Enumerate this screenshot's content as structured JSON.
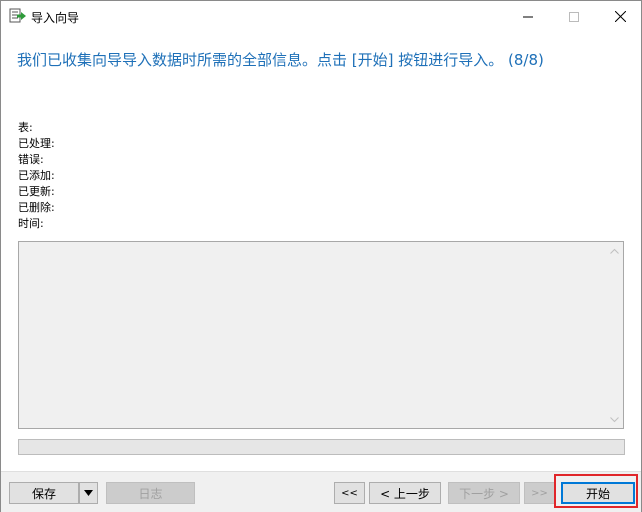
{
  "window": {
    "title": "导入向导"
  },
  "heading": "我们已收集向导导入数据时所需的全部信息。点击 [开始] 按钮进行导入。 (8/8)",
  "info_labels": [
    "表:",
    "已处理:",
    "错误:",
    "已添加:",
    "已更新:",
    "已删除:",
    "时间:"
  ],
  "buttons": {
    "save": "保存",
    "log": "日志",
    "first": "<<",
    "prev": "< 上一步",
    "next": "下一步 >",
    "last": ">>",
    "start": "开始"
  },
  "progress": {
    "value": 0
  },
  "icons": [
    "import-wizard-icon",
    "minimize-icon",
    "maximize-icon",
    "close-icon",
    "scroll-up-arrow-icon",
    "scroll-down-arrow-icon",
    "dropdown-arrow-icon"
  ]
}
